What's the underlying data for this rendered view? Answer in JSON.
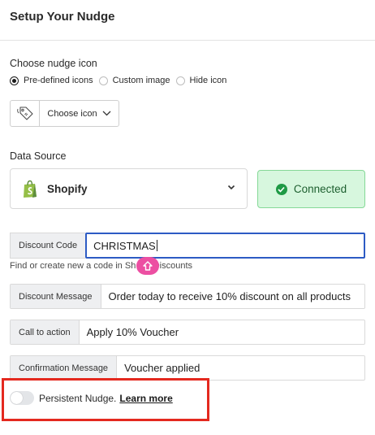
{
  "header": {
    "title": "Setup Your Nudge"
  },
  "icon_section": {
    "label": "Choose nudge icon",
    "options": [
      {
        "label": "Pre-defined icons",
        "checked": true
      },
      {
        "label": "Custom image",
        "checked": false
      },
      {
        "label": "Hide icon",
        "checked": false
      }
    ],
    "picker": {
      "preview_icon": "price-tag-icon",
      "button_label": "Choose icon"
    }
  },
  "data_source": {
    "label": "Data Source",
    "selected": "Shopify",
    "selected_icon": "shopify-bag-icon",
    "status": "Connected",
    "status_color": "#1f9a45"
  },
  "fields": {
    "discount_code": {
      "label": "Discount Code",
      "value": "CHRISTMAS"
    },
    "helper_before": "Find or create new a code in Sh",
    "helper_after": "Discounts",
    "discount_message": {
      "label": "Discount Message",
      "value": "Order today to receive 10% discount on all products"
    },
    "call_to_action": {
      "label": "Call to action",
      "value": "Apply 10% Voucher"
    },
    "confirmation_message": {
      "label": "Confirmation Message",
      "value": "Voucher applied"
    }
  },
  "persistent": {
    "label": "Persistent Nudge.",
    "link": "Learn more",
    "enabled": false,
    "highlight_color": "#e4291f"
  },
  "colors": {
    "accent_focus": "#2d5bc4",
    "connected_bg": "#d7f7de",
    "cursor_badge": "#ec4fa2"
  }
}
